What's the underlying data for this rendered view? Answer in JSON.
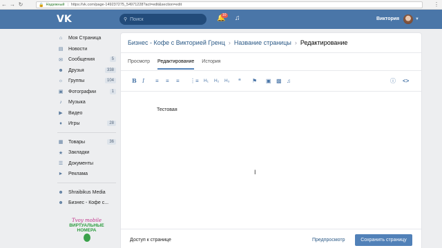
{
  "browser": {
    "secure_label": "Надежный",
    "url": "https://vk.com/page-149237275_54971228?act=edit&section=edit"
  },
  "header": {
    "search_placeholder": "Поиск",
    "notifications_count": "10",
    "user_name": "Виктория"
  },
  "sidebar": {
    "items": [
      {
        "label": "Моя Страница",
        "icon": "home-icon",
        "count": ""
      },
      {
        "label": "Новости",
        "icon": "news-icon",
        "count": ""
      },
      {
        "label": "Сообщения",
        "icon": "messages-icon",
        "count": "5"
      },
      {
        "label": "Друзья",
        "icon": "friends-icon",
        "count": "338"
      },
      {
        "label": "Группы",
        "icon": "groups-icon",
        "count": "104"
      },
      {
        "label": "Фотографии",
        "icon": "photos-icon",
        "count": "1"
      },
      {
        "label": "Музыка",
        "icon": "music-icon",
        "count": ""
      },
      {
        "label": "Видео",
        "icon": "video-icon",
        "count": ""
      },
      {
        "label": "Игры",
        "icon": "games-icon",
        "count": "28"
      }
    ],
    "items2": [
      {
        "label": "Товары",
        "icon": "goods-icon",
        "count": "36"
      },
      {
        "label": "Закладки",
        "icon": "bookmarks-icon",
        "count": ""
      },
      {
        "label": "Документы",
        "icon": "documents-icon",
        "count": ""
      },
      {
        "label": "Реклама",
        "icon": "ads-icon",
        "count": ""
      }
    ],
    "items3": [
      {
        "label": "Shraibikus Media",
        "icon": "community-icon",
        "count": ""
      },
      {
        "label": "Бизнес - Кофе с...",
        "icon": "community-icon",
        "count": ""
      }
    ],
    "ad": {
      "logo": "Tvoy mobile",
      "text_line1": "ВИРТУАЛЬНЫЕ",
      "text_line2": "НОМЕРА"
    }
  },
  "main": {
    "breadcrumb": [
      "Бизнес - Кофе с Викторией Гренц",
      "Название страницы",
      "Редактирование"
    ],
    "tabs": [
      {
        "label": "Просмотр",
        "active": false
      },
      {
        "label": "Редактирование",
        "active": true
      },
      {
        "label": "История",
        "active": false
      }
    ],
    "editor_text": "Тестовая",
    "footer": {
      "access_label": "Доступ к странице",
      "preview_label": "Предпросмотр",
      "save_label": "Сохранить страницу"
    }
  },
  "colors": {
    "header": "#4a76a8",
    "accent": "#5181b8",
    "link": "#2a5885"
  }
}
